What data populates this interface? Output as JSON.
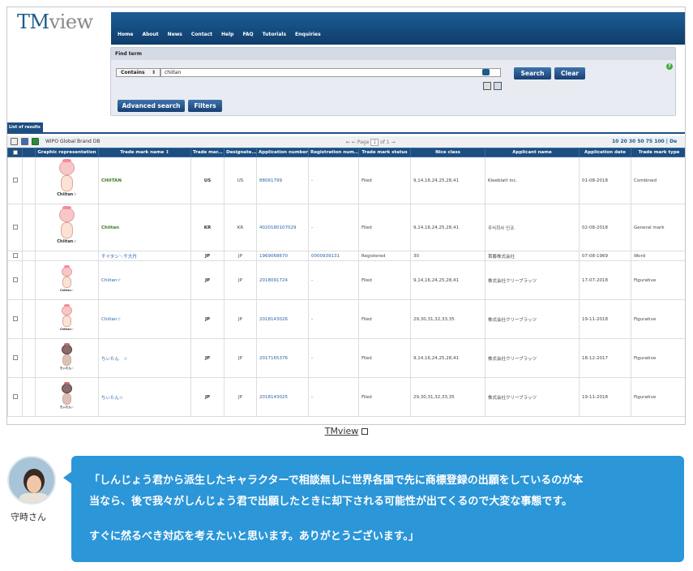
{
  "app": {
    "logo_tm": "TM",
    "logo_view": "view"
  },
  "nav": [
    "Home",
    "About",
    "News",
    "Contact",
    "Help",
    "FAQ",
    "Tutorials",
    "Enquiries"
  ],
  "search": {
    "title": "Find term",
    "mode": "Contains",
    "value": "chiitan",
    "search_label": "Search",
    "clear_label": "Clear",
    "advanced_label": "Advanced search",
    "filters_label": "Filters",
    "help": "?"
  },
  "results": {
    "tab_label": "List of results",
    "db_label": "WIPO Global Brand DB",
    "pager": {
      "prefix": "Page",
      "page": "1",
      "of": "of 1"
    },
    "page_sizes": "10  20  30  50  75  100  | De",
    "columns": [
      "",
      "",
      "Graphic representation",
      "Trade mark name ↕",
      "Trade mar...",
      "Designate...",
      "Application number",
      "Registration num...",
      "Trade mark status",
      "Nice class",
      "Applicant name",
      "Application date",
      "Trade mark type"
    ],
    "rows": [
      {
        "name": "CHIITAN",
        "office": "US",
        "designated": "US",
        "app_no": "88061799",
        "reg_no": "-",
        "status": "Filed",
        "nice": "9,14,16,24,25,28,41",
        "applicant": "Kleeblatt inc.",
        "date": "01-08-2018",
        "type": "Combined",
        "figure": "pink",
        "fig_caption": "Chiitan☆"
      },
      {
        "name": "Chiitan",
        "office": "KR",
        "designated": "KR",
        "app_no": "4020180107029",
        "reg_no": "-",
        "status": "Filed",
        "nice": "9,14,16,24,25,28,41",
        "applicant": "주식회사 인코.",
        "date": "02-08-2018",
        "type": "General mark",
        "figure": "pink",
        "fig_caption": "Chiitan☆"
      },
      {
        "name": "チイタン＼千大丹",
        "office": "JP",
        "designated": "JP",
        "app_no": "1969068670",
        "reg_no": "0000939131",
        "status": "Registered",
        "nice": "30",
        "applicant": "首藤株式会社",
        "date": "07-08-1969",
        "type": "Word",
        "figure": "none",
        "fig_caption": ""
      },
      {
        "name": "Chiitan☆",
        "office": "JP",
        "designated": "JP",
        "app_no": "2018091724",
        "reg_no": "-",
        "status": "Filed",
        "nice": "9,14,16,24,25,28,41",
        "applicant": "株式会社クリーブラッツ",
        "date": "17-07-2018",
        "type": "Figurative",
        "figure": "small",
        "fig_caption": "Chiitan☆"
      },
      {
        "name": "Chiitan☆",
        "office": "JP",
        "designated": "JP",
        "app_no": "2018143026",
        "reg_no": "-",
        "status": "Filed",
        "nice": "29,30,31,32,33,35",
        "applicant": "株式会社クリーブラッツ",
        "date": "19-11-2018",
        "type": "Figurative",
        "figure": "small",
        "fig_caption": "Chiitan☆"
      },
      {
        "name": "ちぃたん　☆",
        "office": "JP",
        "designated": "JP",
        "app_no": "2017165376",
        "reg_no": "-",
        "status": "Filed",
        "nice": "9,14,16,24,25,28,41",
        "applicant": "株式会社クリーブラッツ",
        "date": "18-12-2017",
        "type": "Figurative",
        "figure": "dark",
        "fig_caption": "ちぃたん☆"
      },
      {
        "name": "ちぃたん☆",
        "office": "JP",
        "designated": "JP",
        "app_no": "2018143025",
        "reg_no": "-",
        "status": "Filed",
        "nice": "29,30,31,32,33,35",
        "applicant": "株式会社クリーブラッツ",
        "date": "19-11-2018",
        "type": "Figurative",
        "figure": "dark",
        "fig_caption": "ちぃたん☆"
      }
    ]
  },
  "caption": "TMview",
  "speaker": {
    "name": "守時さん"
  },
  "bubble": {
    "line1": "「しんじょう君から派生したキャラクターで相談無しに世界各国で先に商標登録の出願をしているのが本",
    "line2": "当なら、後で我々がしんじょう君で出願したときに却下される可能性が出てくるので大変な事態です。",
    "line3": "すぐに然るべき対応を考えたいと思います。ありがとうございます。」"
  }
}
